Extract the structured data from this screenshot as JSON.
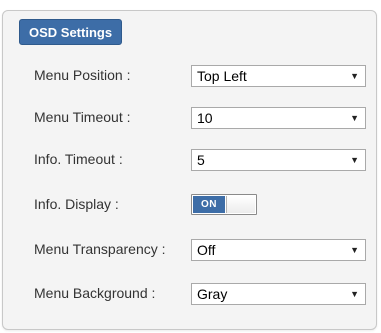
{
  "panel": {
    "title": "OSD Settings"
  },
  "settings": {
    "menu_position": {
      "label": "Menu Position :",
      "value": "Top Left"
    },
    "menu_timeout": {
      "label": "Menu Timeout :",
      "value": "10"
    },
    "info_timeout": {
      "label": "Info. Timeout :",
      "value": "5"
    },
    "info_display": {
      "label": "Info. Display :",
      "toggle_text": "ON",
      "state": "on"
    },
    "menu_transparency": {
      "label": "Menu Transparency :",
      "value": "Off"
    },
    "menu_background": {
      "label": "Menu Background :",
      "value": "Gray"
    }
  },
  "icons": {
    "dropdown_arrow": "▼"
  },
  "colors": {
    "accent": "#3d6da7",
    "panel_background": "#f4f4f4"
  }
}
